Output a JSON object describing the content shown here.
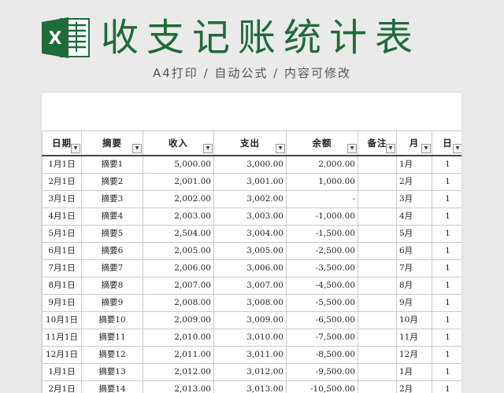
{
  "banner": {
    "title": "收支记账统计表",
    "subtitle": "A4打印  /  自动公式  /  内容可修改",
    "logo_icon": "excel-icon",
    "accent": "#1f6b3a"
  },
  "table": {
    "headers": [
      "日期",
      "摘要",
      "收入",
      "支出",
      "余额",
      "备注",
      "月",
      "日"
    ],
    "rows": [
      [
        "1月1日",
        "摘要1",
        "5,000.00",
        "3,000.00",
        "2,000.00",
        "",
        "1月",
        "1"
      ],
      [
        "2月1日",
        "摘要2",
        "2,001.00",
        "3,001.00",
        "1,000.00",
        "",
        "2月",
        "1"
      ],
      [
        "3月1日",
        "摘要3",
        "2,002.00",
        "3,002.00",
        "-",
        "",
        "3月",
        "1"
      ],
      [
        "4月1日",
        "摘要4",
        "2,003.00",
        "3,003.00",
        "-1,000.00",
        "",
        "4月",
        "1"
      ],
      [
        "5月1日",
        "摘要5",
        "2,504.00",
        "3,004.00",
        "-1,500.00",
        "",
        "5月",
        "1"
      ],
      [
        "6月1日",
        "摘要6",
        "2,005.00",
        "3,005.00",
        "-2,500.00",
        "",
        "6月",
        "1"
      ],
      [
        "7月1日",
        "摘要7",
        "2,006.00",
        "3,006.00",
        "-3,500.00",
        "",
        "7月",
        "1"
      ],
      [
        "8月1日",
        "摘要8",
        "2,007.00",
        "3,007.00",
        "-4,500.00",
        "",
        "8月",
        "1"
      ],
      [
        "9月1日",
        "摘要9",
        "2,008.00",
        "3,008.00",
        "-5,500.00",
        "",
        "9月",
        "1"
      ],
      [
        "10月1日",
        "摘要10",
        "2,009.00",
        "3,009.00",
        "-6,500.00",
        "",
        "10月",
        "1"
      ],
      [
        "11月1日",
        "摘要11",
        "2,010.00",
        "3,010.00",
        "-7,500.00",
        "",
        "11月",
        "1"
      ],
      [
        "12月1日",
        "摘要12",
        "2,011.00",
        "3,011.00",
        "-8,500.00",
        "",
        "12月",
        "1"
      ],
      [
        "1月1日",
        "摘要13",
        "2,012.00",
        "3,012.00",
        "-9,500.00",
        "",
        "1月",
        "1"
      ],
      [
        "2月1日",
        "摘要14",
        "2,013.00",
        "3,013.00",
        "-10,500.00",
        "",
        "2月",
        "1"
      ]
    ]
  }
}
